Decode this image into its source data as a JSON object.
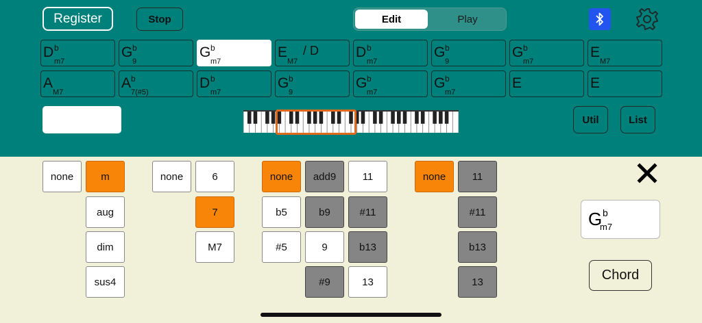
{
  "header": {
    "register_label": "Register",
    "stop_label": "Stop",
    "mode_tabs": [
      "Edit",
      "Play"
    ],
    "selected_tab": "Edit",
    "util_label": "Util",
    "list_label": "List",
    "bluetooth_icon": "bluetooth-icon",
    "settings_icon": "gear-icon",
    "accent_color": "#00807a",
    "bluetooth_color": "#2255ee"
  },
  "chords": [
    {
      "root": "D",
      "acc": "b",
      "qual": "m7",
      "bass": "",
      "selected": false
    },
    {
      "root": "G",
      "acc": "b",
      "qual": "9",
      "bass": "",
      "selected": false
    },
    {
      "root": "G",
      "acc": "b",
      "qual": "m7",
      "bass": "",
      "selected": true
    },
    {
      "root": "E",
      "acc": "",
      "qual": "M7",
      "bass": "/ D",
      "selected": false
    },
    {
      "root": "D",
      "acc": "b",
      "qual": "m7",
      "bass": "",
      "selected": false
    },
    {
      "root": "G",
      "acc": "b",
      "qual": "9",
      "bass": "",
      "selected": false
    },
    {
      "root": "G",
      "acc": "b",
      "qual": "m7",
      "bass": "",
      "selected": false
    },
    {
      "root": "E",
      "acc": "",
      "qual": "M7",
      "bass": "",
      "selected": false
    },
    {
      "root": "A",
      "acc": "",
      "qual": "M7",
      "bass": "",
      "selected": false
    },
    {
      "root": "A",
      "acc": "b",
      "qual": "7(#5)",
      "bass": "",
      "selected": false
    },
    {
      "root": "D",
      "acc": "b",
      "qual": "m7",
      "bass": "",
      "selected": false
    },
    {
      "root": "G",
      "acc": "b",
      "qual": "9",
      "bass": "",
      "selected": false
    },
    {
      "root": "G",
      "acc": "b",
      "qual": "m7",
      "bass": "",
      "selected": false
    },
    {
      "root": "G",
      "acc": "b",
      "qual": "m7",
      "bass": "",
      "selected": false
    },
    {
      "root": "E",
      "acc": "",
      "qual": "",
      "bass": "",
      "selected": false
    },
    {
      "root": "E",
      "acc": "",
      "qual": "",
      "bass": "",
      "selected": false
    }
  ],
  "option_columns": [
    [
      {
        "label": "none",
        "state": "white"
      }
    ],
    [
      {
        "label": "m",
        "state": "orange"
      },
      {
        "label": "aug",
        "state": "white"
      },
      {
        "label": "dim",
        "state": "white"
      },
      {
        "label": "sus4",
        "state": "white"
      }
    ],
    [
      {
        "label": "none",
        "state": "white"
      }
    ],
    [
      {
        "label": "6",
        "state": "white"
      },
      {
        "label": "7",
        "state": "orange"
      },
      {
        "label": "M7",
        "state": "white"
      }
    ],
    [
      {
        "label": "none",
        "state": "orange"
      },
      {
        "label": "b5",
        "state": "white"
      },
      {
        "label": "#5",
        "state": "white"
      }
    ],
    [
      {
        "label": "add9",
        "state": "gray"
      },
      {
        "label": "b9",
        "state": "gray"
      },
      {
        "label": "9",
        "state": "white"
      },
      {
        "label": "#9",
        "state": "gray"
      }
    ],
    [
      {
        "label": "11",
        "state": "white"
      },
      {
        "label": "#11",
        "state": "gray"
      },
      {
        "label": "b13",
        "state": "gray"
      },
      {
        "label": "13",
        "state": "white"
      }
    ],
    [
      {
        "label": "none",
        "state": "orange"
      }
    ],
    [
      {
        "label": "11",
        "state": "gray"
      },
      {
        "label": "#11",
        "state": "gray"
      },
      {
        "label": "b13",
        "state": "gray"
      },
      {
        "label": "13",
        "state": "gray"
      }
    ]
  ],
  "preview": {
    "root": "G",
    "acc": "b",
    "qual": "m7"
  },
  "chord_button_label": "Chord",
  "close_icon": "close-icon",
  "colors": {
    "selected": "#f98508",
    "disabled": "#858585",
    "highlight": "#e06a1c"
  }
}
